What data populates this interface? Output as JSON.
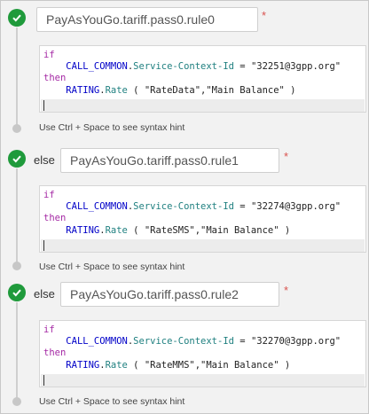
{
  "rules": [
    {
      "prefix": "",
      "name": "PayAsYouGo.tariff.pass0.rule0",
      "required": "*",
      "code": {
        "if": "if",
        "then": "then",
        "cond_obj": "CALL_COMMON",
        "cond_prop": "Service-Context-Id",
        "cond_eq": " = ",
        "cond_val": "\"32251@3gpp.org\"",
        "act_obj": "RATING",
        "act_prop": "Rate",
        "act_args": " ( \"RateData\",\"Main Balance\" )"
      },
      "hint": "Use Ctrl + Space to see syntax hint"
    },
    {
      "prefix": "else",
      "name": "PayAsYouGo.tariff.pass0.rule1",
      "required": "*",
      "code": {
        "if": "if",
        "then": "then",
        "cond_obj": "CALL_COMMON",
        "cond_prop": "Service-Context-Id",
        "cond_eq": " = ",
        "cond_val": "\"32274@3gpp.org\"",
        "act_obj": "RATING",
        "act_prop": "Rate",
        "act_args": " ( \"RateSMS\",\"Main Balance\" )"
      },
      "hint": "Use Ctrl + Space to see syntax hint"
    },
    {
      "prefix": "else",
      "name": "PayAsYouGo.tariff.pass0.rule2",
      "required": "*",
      "code": {
        "if": "if",
        "then": "then",
        "cond_obj": "CALL_COMMON",
        "cond_prop": "Service-Context-Id",
        "cond_eq": " = ",
        "cond_val": "\"32270@3gpp.org\"",
        "act_obj": "RATING",
        "act_prop": "Rate",
        "act_args": " ( \"RateMMS\",\"Main Balance\" )"
      },
      "hint": "Use Ctrl + Space to see syntax hint"
    }
  ],
  "colors": {
    "check": "#1f9a3b",
    "keyword": "#a52aa5",
    "object": "#0000c8",
    "property": "#208080",
    "required": "#d9534f"
  },
  "icons": {
    "status": "checkmark-circle-icon"
  }
}
